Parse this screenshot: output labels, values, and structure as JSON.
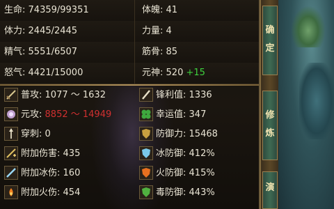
{
  "stats_top": [
    {
      "left_label": "生命:",
      "left_value": "74359/99351",
      "right_label": "体魄:",
      "right_value": "41"
    },
    {
      "left_label": "体力:",
      "left_value": "2445/2445",
      "right_label": "力量:",
      "right_value": "4"
    },
    {
      "left_label": "精气:",
      "left_value": "5551/6507",
      "right_label": "筋骨:",
      "right_value": "85"
    },
    {
      "left_label": "怒气:",
      "left_value": "4421/15000",
      "right_label": "元神:",
      "right_value": "520",
      "right_bonus": "+15"
    }
  ],
  "stats_icon": [
    {
      "left_label": "普攻:",
      "left_value": "1077 ～ 1632",
      "left_icon": "sword-icon",
      "right_label": "锋利值:",
      "right_value": "1336",
      "right_icon": "blade-icon"
    },
    {
      "left_label": "元攻:",
      "left_value": "8852 ～ 14949",
      "left_icon": "magic-orb-icon",
      "right_label": "幸运值:",
      "right_value": "347",
      "right_icon": "clover-icon"
    },
    {
      "left_label": "穿刺:",
      "left_value": "0",
      "left_icon": "spear-icon",
      "right_label": "防御力:",
      "right_value": "15468",
      "right_icon": "shield-icon"
    },
    {
      "left_label": "附加伤害:",
      "left_value": "435",
      "left_icon": "sword-plus-icon",
      "right_label": "冰防御:",
      "right_value": "412%",
      "right_icon": "ice-shield-icon"
    },
    {
      "left_label": "附加冰伤:",
      "left_value": "160",
      "left_icon": "ice-sword-icon",
      "right_label": "火防御:",
      "right_value": "415%",
      "right_icon": "fire-shield-icon"
    },
    {
      "left_label": "附加火伤:",
      "left_value": "454",
      "left_icon": "fire-sword-icon",
      "right_label": "毒防御:",
      "right_value": "443%",
      "right_icon": "poison-shield-icon"
    }
  ],
  "buttons": [
    {
      "chars": [
        "确",
        "定"
      ]
    },
    {
      "chars": [
        "修",
        "炼"
      ]
    },
    {
      "chars": [
        "演"
      ]
    }
  ],
  "colors": {
    "accent_gold": "#b0915a",
    "bonus_green": "#3ed13e",
    "magic_red": "#d03030"
  }
}
